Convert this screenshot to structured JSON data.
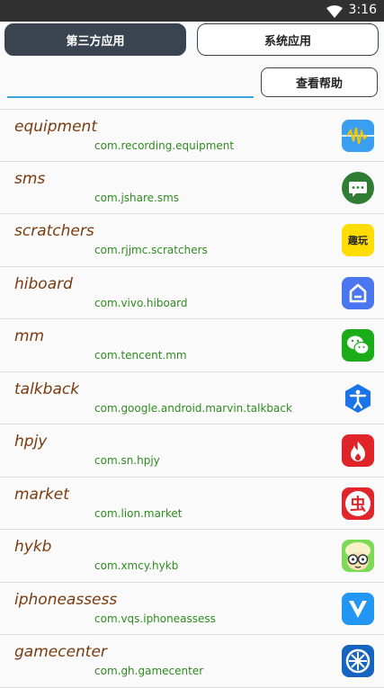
{
  "status_bar": {
    "time": "3:16",
    "icons": [
      "wifi-icon"
    ]
  },
  "tabs": [
    {
      "label": "第三方应用",
      "active": true
    },
    {
      "label": "系统应用",
      "active": false
    }
  ],
  "search": {
    "value": "",
    "placeholder": ""
  },
  "help_button": {
    "label": "查看帮助"
  },
  "apps": [
    {
      "name": "equipment",
      "package": "com.recording.equipment",
      "icon": "recorder-waveform-icon"
    },
    {
      "name": "sms",
      "package": "com.jshare.sms",
      "icon": "chat-bubble-icon"
    },
    {
      "name": "scratchers",
      "package": "com.rjjmc.scratchers",
      "icon": "quwan-icon",
      "icon_text": "趣玩"
    },
    {
      "name": "hiboard",
      "package": "com.vivo.hiboard",
      "icon": "home-icon"
    },
    {
      "name": "mm",
      "package": "com.tencent.mm",
      "icon": "wechat-icon"
    },
    {
      "name": "talkback",
      "package": "com.google.android.marvin.talkback",
      "icon": "accessibility-icon"
    },
    {
      "name": "hpjy",
      "package": "com.sn.hpjy",
      "icon": "flame-icon"
    },
    {
      "name": "market",
      "package": "com.lion.market",
      "icon": "chong-icon",
      "icon_text": "虫"
    },
    {
      "name": "hykb",
      "package": "com.xmcy.hykb",
      "icon": "cartoon-face-icon"
    },
    {
      "name": "iphoneassess",
      "package": "com.vqs.iphoneassess",
      "icon": "v-check-icon"
    },
    {
      "name": "gamecenter",
      "package": "com.gh.gamecenter",
      "icon": "game-wheel-icon"
    }
  ],
  "colors": {
    "status_bar": "#303030",
    "active_tab": "#3a4350",
    "search_underline": "#3aa3e3",
    "app_name": "#7a3b0e",
    "package": "#2e8b1f",
    "divider": "#dcdcdc"
  }
}
